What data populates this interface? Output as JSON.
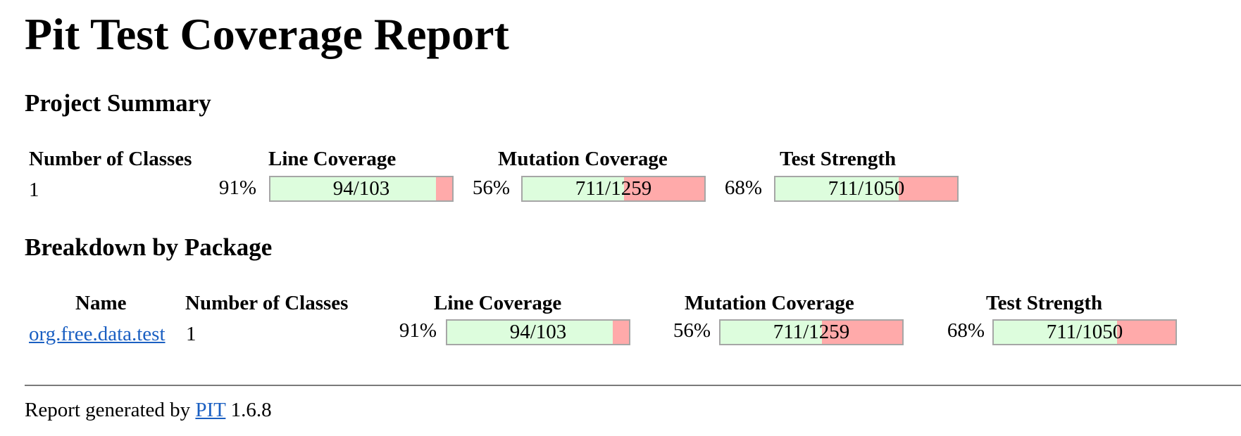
{
  "report": {
    "title": "Pit Test Coverage Report",
    "project_summary_heading": "Project Summary",
    "package_breakdown_heading": "Breakdown by Package"
  },
  "summary": {
    "headers": {
      "classes": "Number of Classes",
      "line": "Line Coverage",
      "mutation": "Mutation Coverage",
      "strength": "Test Strength"
    },
    "classes": "1",
    "line": {
      "percent": "91%",
      "ratio": "94/103",
      "fraction": 0.91
    },
    "mutation": {
      "percent": "56%",
      "ratio": "711/1259",
      "fraction": 0.56
    },
    "strength": {
      "percent": "68%",
      "ratio": "711/1050",
      "fraction": 0.68
    }
  },
  "packages": {
    "headers": {
      "name": "Name",
      "classes": "Number of Classes",
      "line": "Line Coverage",
      "mutation": "Mutation Coverage",
      "strength": "Test Strength"
    },
    "rows": [
      {
        "name": "org.free.data.test",
        "classes": "1",
        "line": {
          "percent": "91%",
          "ratio": "94/103",
          "fraction": 0.91
        },
        "mutation": {
          "percent": "56%",
          "ratio": "711/1259",
          "fraction": 0.56
        },
        "strength": {
          "percent": "68%",
          "ratio": "711/1050",
          "fraction": 0.68
        }
      }
    ]
  },
  "footer": {
    "prefix": "Report generated by",
    "link_text": "PIT",
    "version": "1.6.8"
  },
  "colors": {
    "covered": "#ddfddd",
    "uncovered": "#ffaaaa",
    "link": "#1a5fc2"
  }
}
